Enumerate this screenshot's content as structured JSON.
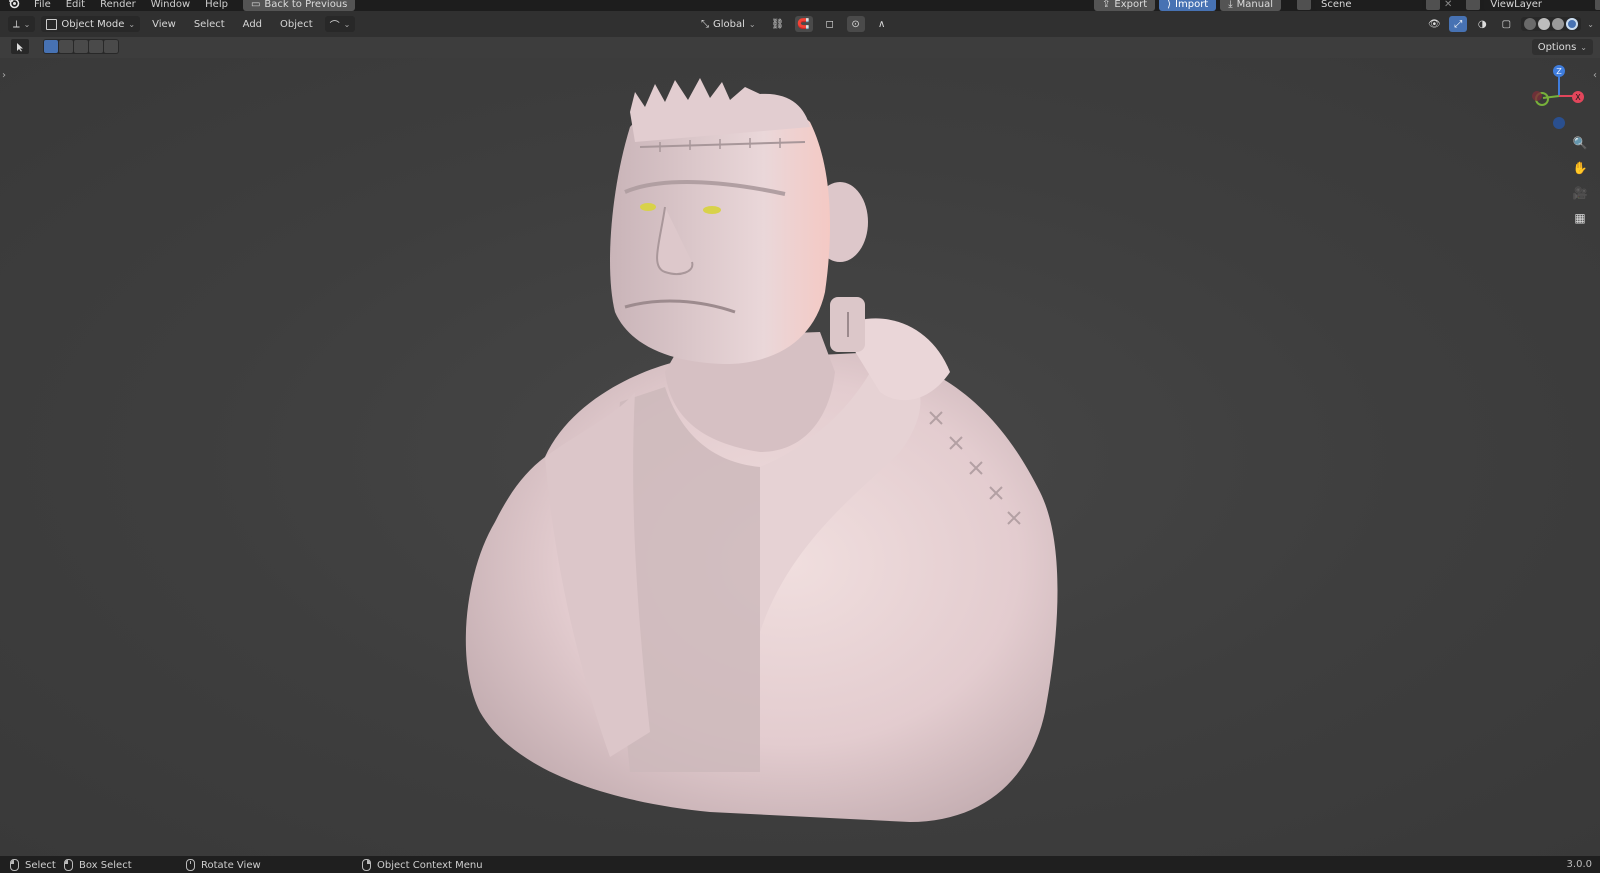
{
  "topbar": {
    "menus": [
      "File",
      "Edit",
      "Render",
      "Window",
      "Help"
    ],
    "back_button": "Back to Previous",
    "export_label": "Export",
    "import_label": "Import",
    "manual_label": "Manual",
    "scene_name": "Scene",
    "view_layer_name": "ViewLayer"
  },
  "header": {
    "mode_label": "Object Mode",
    "menus": [
      "View",
      "Select",
      "Add",
      "Object"
    ],
    "transform_orientation": "Global",
    "options_label": "Options"
  },
  "gizmo": {
    "z_label": "Z",
    "x_label": "X"
  },
  "status": {
    "select_label": "Select",
    "box_select_label": "Box Select",
    "rotate_label": "Rotate View",
    "context_menu_label": "Object Context Menu",
    "version": "3.0.0"
  },
  "colors": {
    "accent": "#4772b3",
    "x_axis": "#e2465b",
    "y_axis": "#77b03a",
    "z_axis": "#3f7ddd"
  }
}
